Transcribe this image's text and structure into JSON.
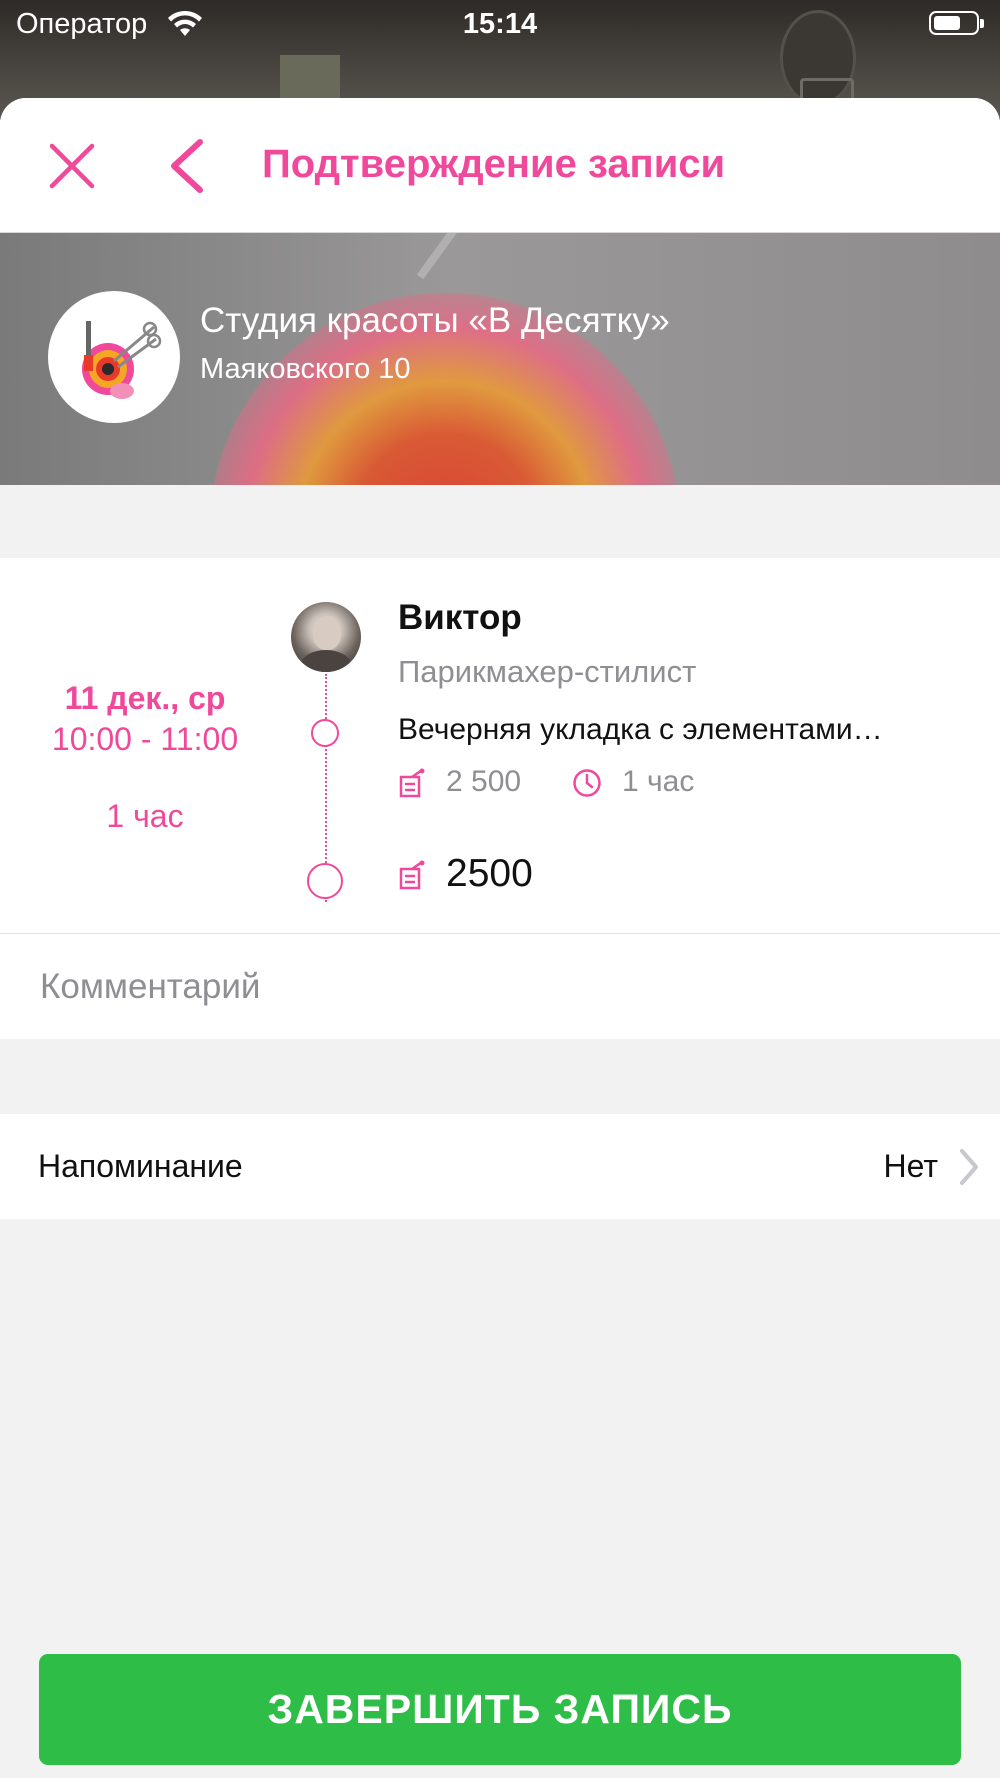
{
  "status_bar": {
    "carrier": "Оператор",
    "time": "15:14"
  },
  "nav": {
    "title": "Подтверждение записи",
    "close_icon": "close-icon",
    "back_icon": "chevron-left-icon"
  },
  "salon": {
    "name": "Студия красоты «В Десятку»",
    "address": "Маяковского 10"
  },
  "appointment": {
    "date": "11 дек., ср",
    "time": "10:00 - 11:00",
    "duration": "1 час",
    "master_name": "Виктор",
    "master_role": "Парикмахер-стилист",
    "service_name": "Вечерняя укладка с элементами…",
    "service_price": "2 500",
    "service_duration": "1 час",
    "total_price": "2500"
  },
  "comment": {
    "placeholder": "Комментарий",
    "value": ""
  },
  "reminder": {
    "label": "Напоминание",
    "value": "Нет"
  },
  "finish_button": {
    "label": "ЗАВЕРШИТЬ ЗАПИСЬ"
  },
  "colors": {
    "accent": "#f0489a",
    "button": "#2ebd47",
    "secondary_text": "#8e8e93"
  }
}
